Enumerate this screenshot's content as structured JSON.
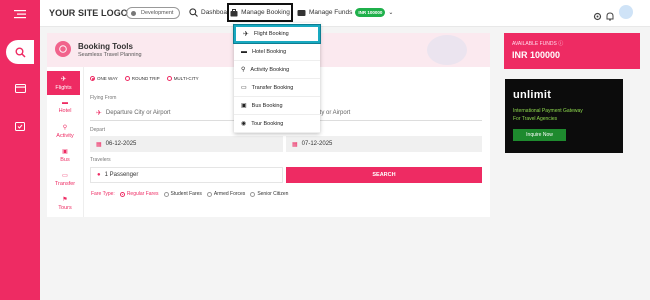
{
  "header": {
    "logo": "YOUR SITE LOGO",
    "env_label": "Development",
    "dashboard_label": "Dashboard",
    "manage_booking_label": "Manage Booking",
    "manage_funds_label": "Manage Funds",
    "funds_badge": "INR 100000"
  },
  "dropdown": {
    "items": [
      {
        "label": "Flight Booking",
        "icon": "plane-icon"
      },
      {
        "label": "Hotel Booking",
        "icon": "bed-icon"
      },
      {
        "label": "Activity Booking",
        "icon": "bike-icon"
      },
      {
        "label": "Transfer Booking",
        "icon": "car-icon"
      },
      {
        "label": "Bus Booking",
        "icon": "bus-icon"
      },
      {
        "label": "Tour Booking",
        "icon": "camera-icon"
      }
    ]
  },
  "booking": {
    "title": "Booking Tools",
    "subtitle": "Seamless Travel Planning",
    "tabs": [
      "Flights",
      "Hotel",
      "Activity",
      "Bus",
      "Transfer",
      "Tours"
    ],
    "trip_types": [
      "ONE WAY",
      "ROUND TRIP",
      "MULTI-CITY"
    ],
    "flying_from_label": "Flying From",
    "from_placeholder": "Departure City or Airport",
    "to_placeholder": "City or Airport",
    "depart_label": "Depart",
    "depart_date": "06-12-2025",
    "return_date": "07-12-2025",
    "travelers_label": "Travelers",
    "travelers_value": "1 Passenger",
    "search_label": "SEARCH",
    "fare_type_label": "Fare Type:",
    "fare_types": [
      "Regular Fares",
      "Student Fares",
      "Armed Forces",
      "Senior Citizen"
    ]
  },
  "funds": {
    "label": "AVAILABLE FUNDS",
    "value": "INR 100000"
  },
  "ad": {
    "brand": "unlimit",
    "line1": "International Payment Gateway",
    "line2": "For Travel Agencies",
    "cta": "Inquire Now"
  },
  "colors": {
    "brand": "#ee2b63",
    "highlight": "#18a9c0",
    "badge": "#1fb04b"
  }
}
